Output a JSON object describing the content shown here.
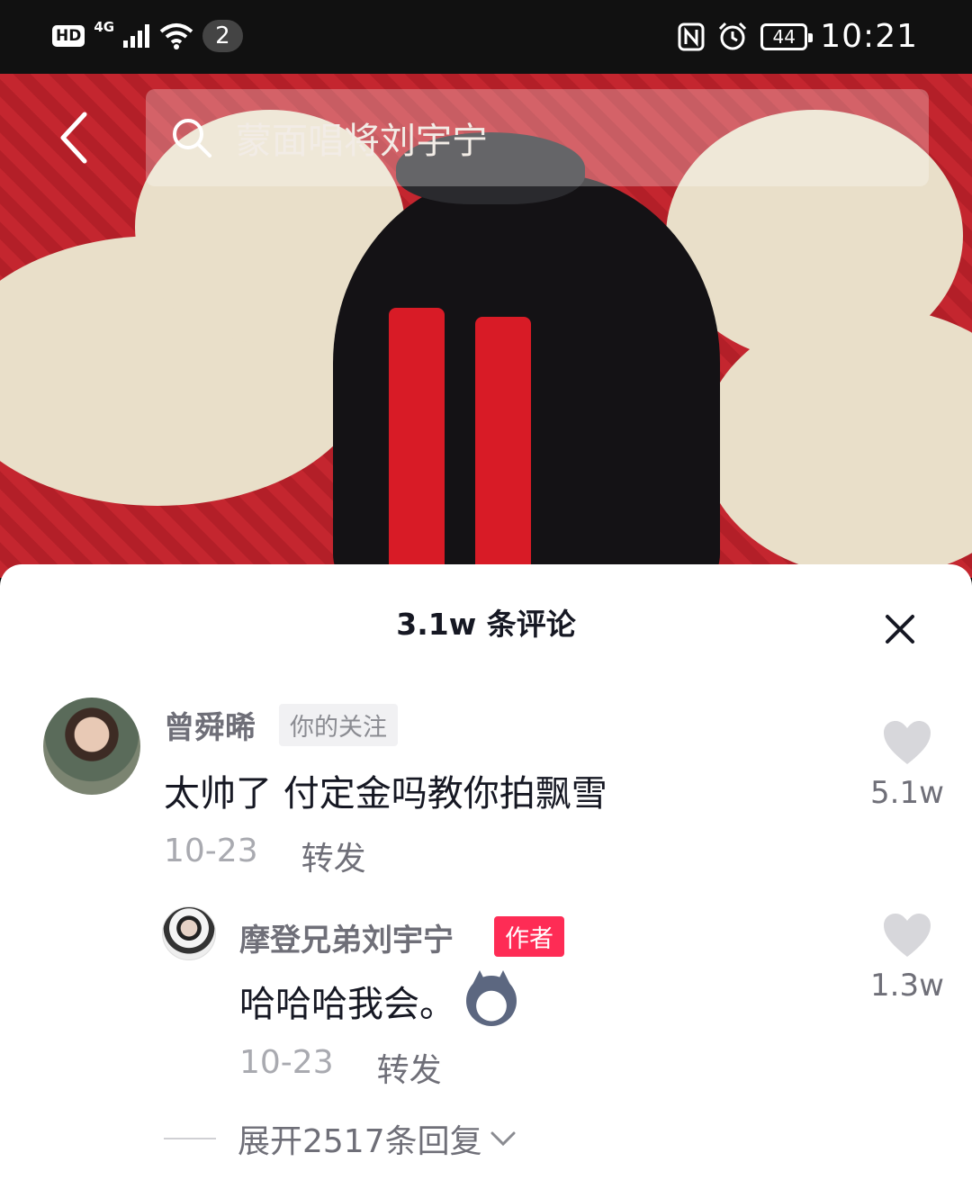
{
  "status_bar": {
    "hd": "HD",
    "network": "4G",
    "notification_count": "2",
    "battery": "44",
    "time": "10:21"
  },
  "search": {
    "query": "蒙面唱将刘宇宁"
  },
  "comments_panel": {
    "title": "3.1w 条评论",
    "comments": [
      {
        "username": "曾舜晞",
        "tag": "你的关注",
        "text": "太帅了 付定金吗教你拍飘雪",
        "date": "10-23",
        "share_label": "转发",
        "likes": "5.1w"
      },
      {
        "username": "摩登兄弟刘宇宁",
        "tag": "作者",
        "text": "哈哈哈我会。",
        "date": "10-23",
        "share_label": "转发",
        "likes": "1.3w"
      }
    ],
    "expand_label": "展开2517条回复"
  },
  "colors": {
    "author_tag": "#fe2c55",
    "like_heart": "#d7d7db"
  }
}
